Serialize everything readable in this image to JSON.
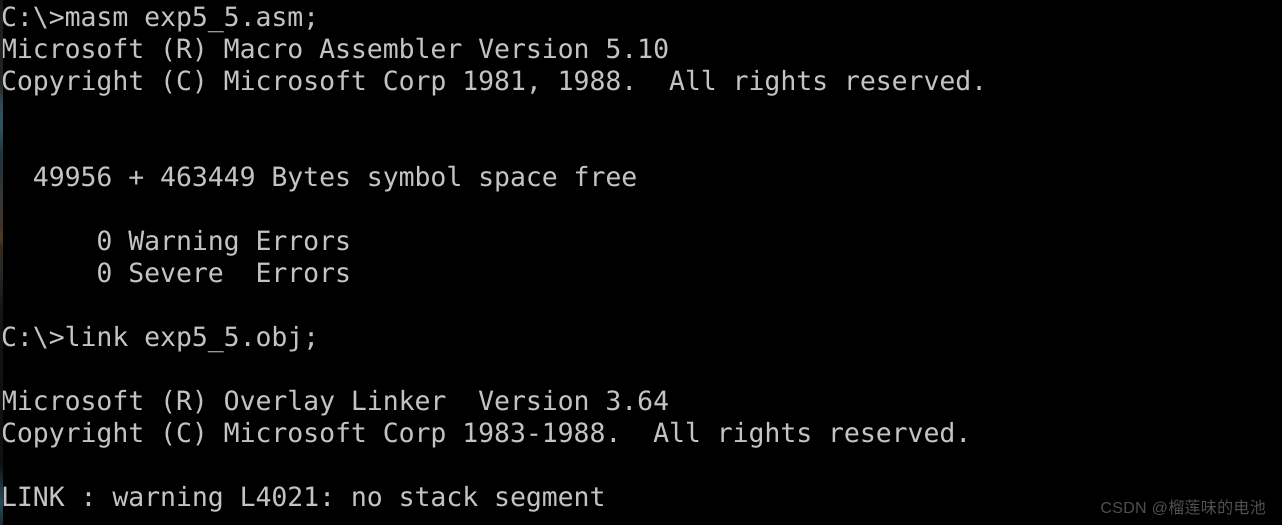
{
  "window": {
    "title": "MASM / LINK console output",
    "background_color": "#000000",
    "text_color": "#c3c3c3"
  },
  "console": {
    "prompt": "C:\\>",
    "lines": [
      {
        "id": "cmd-masm",
        "text": "C:\\>masm exp5_5.asm;"
      },
      {
        "id": "masm-banner",
        "text": "Microsoft (R) Macro Assembler Version 5.10"
      },
      {
        "id": "masm-copyright",
        "text": "Copyright (C) Microsoft Corp 1981, 1988.  All rights reserved."
      },
      {
        "id": "blank-1",
        "text": ""
      },
      {
        "id": "blank-2",
        "text": ""
      },
      {
        "id": "symbol-space",
        "text": "  49956 + 463449 Bytes symbol space free"
      },
      {
        "id": "blank-3",
        "text": ""
      },
      {
        "id": "warning-errors",
        "text": "      0 Warning Errors"
      },
      {
        "id": "severe-errors",
        "text": "      0 Severe  Errors"
      },
      {
        "id": "blank-4",
        "text": ""
      },
      {
        "id": "cmd-link",
        "text": "C:\\>link exp5_5.obj;"
      },
      {
        "id": "blank-5",
        "text": ""
      },
      {
        "id": "link-banner",
        "text": "Microsoft (R) Overlay Linker  Version 3.64"
      },
      {
        "id": "link-copyright",
        "text": "Copyright (C) Microsoft Corp 1983-1988.  All rights reserved."
      },
      {
        "id": "blank-6",
        "text": ""
      },
      {
        "id": "link-warning",
        "text": "LINK : warning L4021: no stack segment"
      }
    ]
  },
  "commands": {
    "masm": "masm exp5_5.asm;",
    "link": "link exp5_5.obj;"
  },
  "assembler": {
    "product": "Microsoft (R) Macro Assembler",
    "version": "5.10",
    "copyright_years": "1981, 1988",
    "symbol_space_used": "49956",
    "symbol_space_free": "463449",
    "warning_errors": "0",
    "severe_errors": "0"
  },
  "linker": {
    "product": "Microsoft (R) Overlay Linker",
    "version": "3.64",
    "copyright_years": "1983-1988",
    "warning_code": "L4021",
    "warning_message": "no stack segment"
  },
  "watermark": {
    "text": "CSDN @榴莲味的电池",
    "color": "#4f4f4f"
  }
}
